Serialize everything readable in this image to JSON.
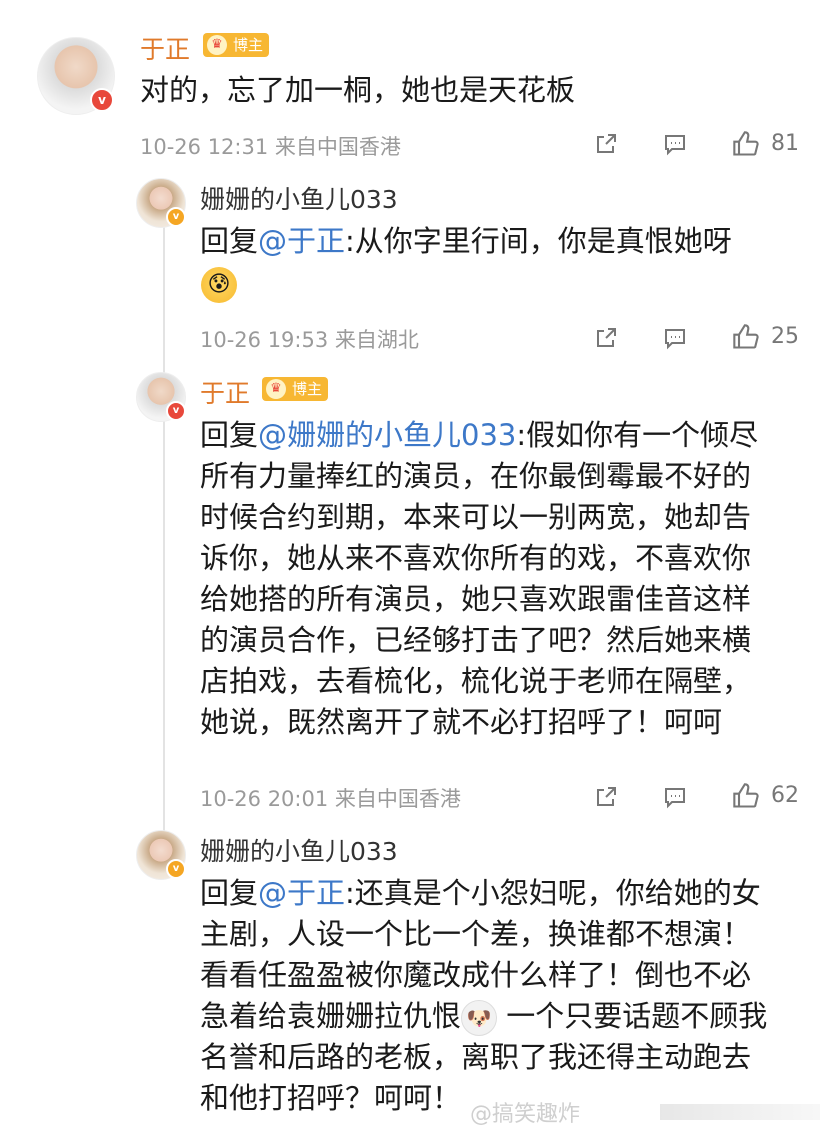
{
  "comments": [
    {
      "author": "于正",
      "badge": "博主",
      "text": "对的，忘了加一桐，她也是天花板",
      "meta": "10-26 12:31 来自中国香港",
      "likes": "81"
    },
    {
      "author": "姗姗的小鱼儿033",
      "reply_prefix": "回复",
      "mention": "@于正",
      "text": ":从你字里行间，你是真恨她呀",
      "emoji": "😰",
      "meta": "10-26 19:53 来自湖北",
      "likes": "25"
    },
    {
      "author": "于正",
      "badge": "博主",
      "reply_prefix": "回复",
      "mention": "@姗姗的小鱼儿033",
      "lines": [
        ":假如你有一个倾尽",
        "所有力量捧红的演员，在你最倒霉最不好的",
        "时候合约到期，本来可以一别两宽，她却告",
        "诉你，她从来不喜欢你所有的戏，不喜欢你",
        "给她搭的所有演员，她只喜欢跟雷佳音这样",
        "的演员合作，已经够打击了吧？然后她来横",
        "店拍戏，去看梳化，梳化说于老师在隔壁，",
        "她说，既然离开了就不必打招呼了！呵呵"
      ],
      "meta": "10-26 20:01 来自中国香港",
      "likes": "62"
    },
    {
      "author": "姗姗的小鱼儿033",
      "reply_prefix": "回复",
      "mention": "@于正",
      "lines": [
        ":还真是个小怨妇呢，你给她的女",
        "主剧，人设一个比一个差，换谁都不想演！",
        "看看任盈盈被你魔改成什么样了！倒也不必",
        "急着给袁姗姗拉仇恨",
        " 一个只要话题不顾我",
        "名誉和后路的老板，离职了我还得主动跑去",
        "和他打招呼？呵呵！"
      ],
      "inline_emoji": "🐶"
    }
  ],
  "watermark": "@搞笑趣炸"
}
